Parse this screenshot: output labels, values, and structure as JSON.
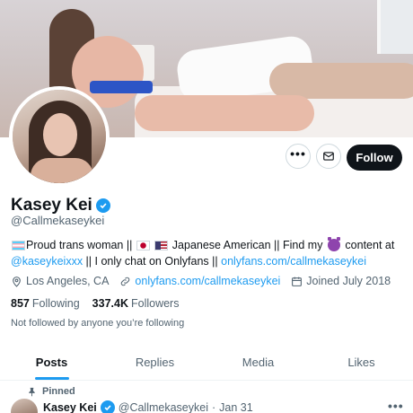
{
  "profile": {
    "display_name": "Kasey Kei",
    "handle": "@Callmekaseykei"
  },
  "actions": {
    "more_label": "•••",
    "follow_label": "Follow"
  },
  "bio": {
    "part1": "Proud trans woman || ",
    "part2": " Japanese American || Find my ",
    "part3": " content at",
    "link1": "@kaseykeixxx",
    "part4": " || I only chat on Onlyfans || ",
    "link2": "onlyfans.com/callmekaseykei"
  },
  "meta": {
    "location": "Los Angeles, CA",
    "website": "onlyfans.com/callmekaseykei",
    "joined": "Joined July 2018"
  },
  "stats": {
    "following_count": "857",
    "following_label": "Following",
    "followers_count": "337.4K",
    "followers_label": "Followers"
  },
  "not_followed_text": "Not followed by anyone you’re following",
  "tabs": [
    {
      "label": "Posts",
      "active": true
    },
    {
      "label": "Replies",
      "active": false
    },
    {
      "label": "Media",
      "active": false
    },
    {
      "label": "Likes",
      "active": false
    }
  ],
  "pinned_post": {
    "pinned_label": "Pinned",
    "author_name": "Kasey Kei",
    "author_handle": "@Callmekaseykei",
    "separator": "·",
    "date": "Jan 31",
    "more_label": "•••"
  },
  "colors": {
    "accent": "#1d9bf0",
    "text": "#0f1419",
    "secondary_text": "#536471",
    "follow_button_bg": "#0f1419"
  },
  "icons": [
    "verified-badge-icon",
    "more-icon",
    "mail-icon",
    "location-icon",
    "link-icon",
    "calendar-icon",
    "pin-icon"
  ]
}
